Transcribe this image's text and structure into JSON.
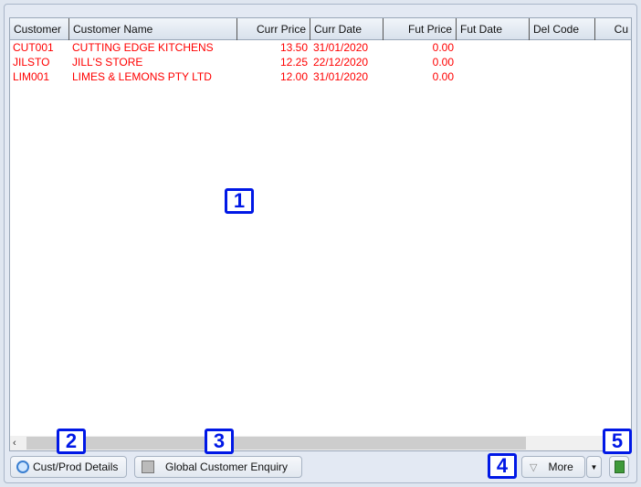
{
  "table": {
    "columns": [
      "Customer",
      "Customer Name",
      "Curr Price",
      "Curr Date",
      "Fut Price",
      "Fut Date",
      "Del Code",
      "Cu"
    ],
    "rows": [
      {
        "customer": "CUT001",
        "name": "CUTTING EDGE KITCHENS",
        "curr_price": "13.50",
        "curr_date": "31/01/2020",
        "fut_price": "0.00"
      },
      {
        "customer": "JILSTO",
        "name": "JILL'S STORE",
        "curr_price": "12.25",
        "curr_date": "22/12/2020",
        "fut_price": "0.00"
      },
      {
        "customer": "LIM001",
        "name": "LIMES & LEMONS PTY LTD",
        "curr_price": "12.00",
        "curr_date": "31/01/2020",
        "fut_price": "0.00"
      }
    ],
    "row_text_color": "#ff0000"
  },
  "buttons": {
    "cust_prod": "Cust/Prod Details",
    "global_enquiry": "Global Customer Enquiry",
    "more": "More"
  },
  "badges": [
    "1",
    "2",
    "3",
    "4",
    "5"
  ],
  "icons": {
    "cust_prod": "magnifier-icon",
    "global_enquiry": "cabinet-icon",
    "more": "triangle-down-icon",
    "excel": "excel-export-icon"
  }
}
